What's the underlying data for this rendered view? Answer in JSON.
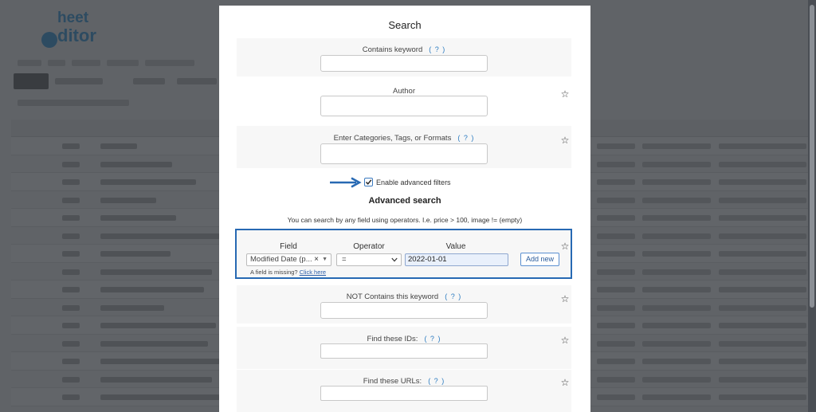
{
  "modal": {
    "title": "Search",
    "help_label": "( ? )",
    "fields": {
      "contains_keyword": {
        "label": "Contains keyword",
        "value": "",
        "has_help": true
      },
      "author": {
        "label": "Author",
        "value": ""
      },
      "categories": {
        "label": "Enter Categories, Tags, or Formats",
        "value": ""
      },
      "not_contains": {
        "label": "NOT Contains this keyword",
        "value": ""
      },
      "find_ids": {
        "label": "Find these IDs:",
        "value": ""
      },
      "find_urls": {
        "label": "Find these URLs:",
        "value": ""
      }
    },
    "advanced_filters": {
      "label": "Enable advanced filters",
      "checked": true
    },
    "advanced_search": {
      "title": "Advanced search",
      "description": "You can search by any field using operators. I.e. price > 100, image != (empty)",
      "field_header": "Field",
      "operator_header": "Operator",
      "value_header": "Value",
      "field_value": "Modified Date (p...",
      "operator_value": "=",
      "value_value": "2022-01-01",
      "add_button": "Add new",
      "missing_text": "A field is missing?",
      "missing_link": "Click here"
    }
  },
  "colors": {
    "accent": "#2769b3",
    "link": "#2b7bc0",
    "overlay": "#2c3035",
    "field_bg": "#f7f7f7"
  },
  "icons": {
    "favorite": "star-outline-icon",
    "remove": "x-icon",
    "dropdown": "chevron-down-icon",
    "pointer": "arrow-right-icon",
    "checked": "checkmark-icon"
  }
}
